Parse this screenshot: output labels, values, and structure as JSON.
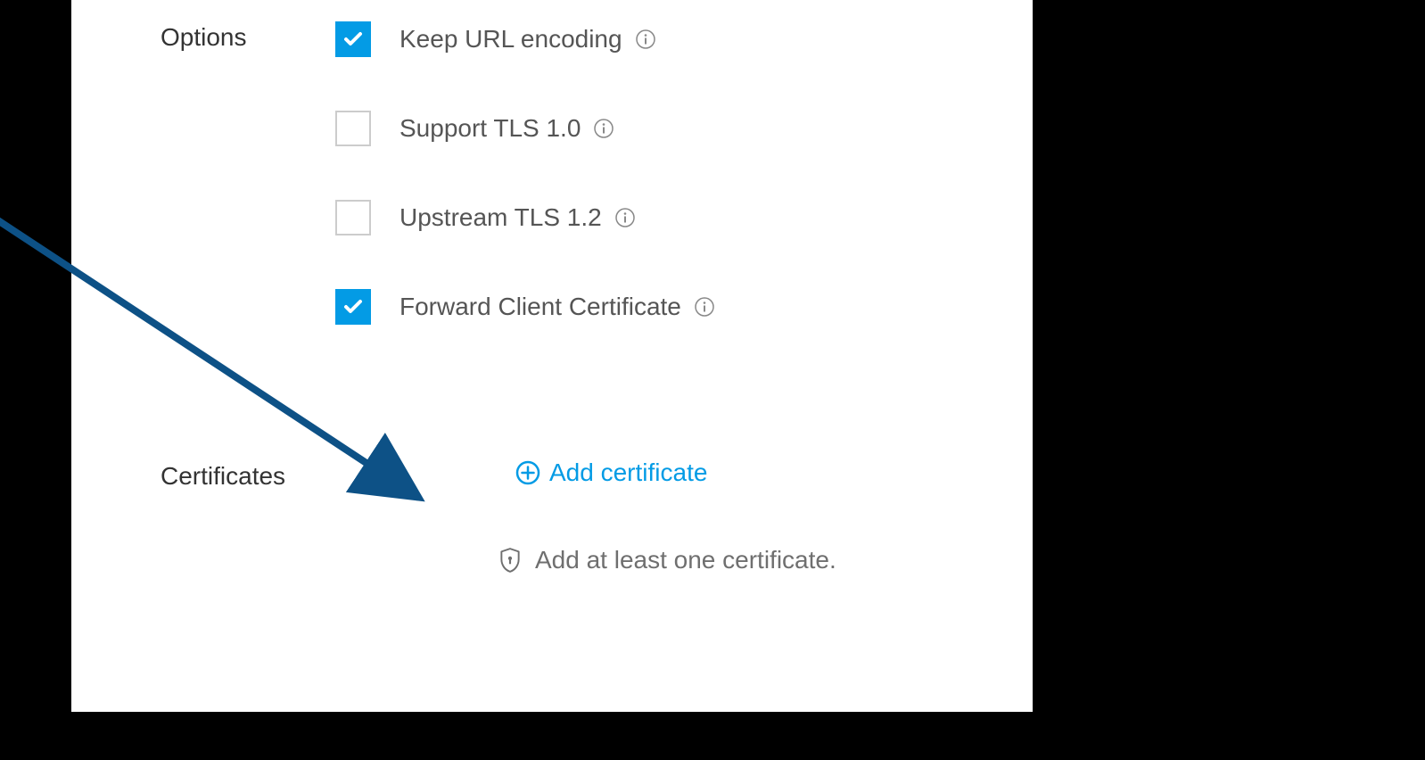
{
  "sections": {
    "options": {
      "label": "Options",
      "items": [
        {
          "label": "Keep URL encoding",
          "checked": true
        },
        {
          "label": "Support TLS 1.0",
          "checked": false
        },
        {
          "label": "Upstream TLS 1.2",
          "checked": false
        },
        {
          "label": "Forward Client Certificate",
          "checked": true
        }
      ]
    },
    "certificates": {
      "label": "Certificates",
      "addLabel": "Add certificate",
      "hint": "Add at least one certificate."
    }
  },
  "colors": {
    "accent": "#039be5",
    "text": "#555555",
    "label": "#333333",
    "hint": "#6f6f6f",
    "arrow": "#0d5186"
  }
}
